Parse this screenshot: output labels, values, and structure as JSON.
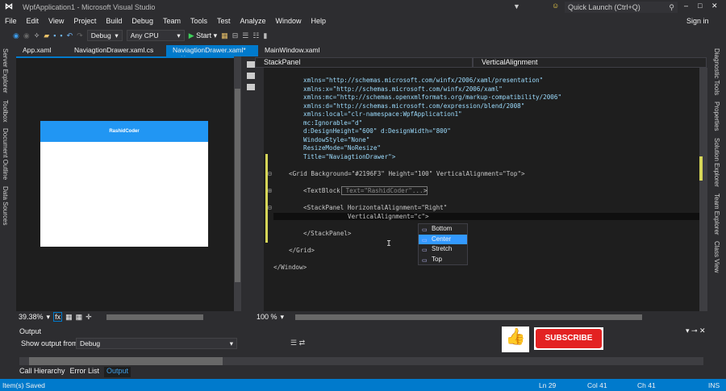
{
  "window": {
    "title": "WpfApplication1 - Microsoft Visual Studio",
    "quick_launch": "Quick Launch (Ctrl+Q)",
    "sign_in": "Sign in"
  },
  "menu": [
    "File",
    "Edit",
    "View",
    "Project",
    "Build",
    "Debug",
    "Team",
    "Tools",
    "Test",
    "Analyze",
    "Window",
    "Help"
  ],
  "toolbar": {
    "config": "Debug",
    "platform": "Any CPU",
    "start": "Start"
  },
  "left_strip": [
    "Server Explorer",
    "Toolbox",
    "Document Outline",
    "Data Sources"
  ],
  "right_strip": [
    "Diagnostic Tools",
    "Properties",
    "Solution Explorer",
    "Team Explorer",
    "Class View"
  ],
  "tabs": [
    {
      "label": "App.xaml"
    },
    {
      "label": "NaviagtionDrawer.xaml.cs"
    },
    {
      "label": "NaviagtionDrawer.xaml*"
    },
    {
      "label": "MainWindow.xaml"
    }
  ],
  "nav": {
    "left": "StackPanel",
    "right": "VerticalAlignment"
  },
  "designer": {
    "header_text": "RashidCoder",
    "header_color": "#2196F3",
    "zoom": "39.38%"
  },
  "code": {
    "lines": [
      "xmlns=\"http://schemas.microsoft.com/winfx/2006/xaml/presentation\"",
      "xmlns:x=\"http://schemas.microsoft.com/winfx/2006/xaml\"",
      "xmlns:mc=\"http://schemas.openxmlformats.org/markup-compatibility/2006\"",
      "xmlns:d=\"http://schemas.microsoft.com/expression/blend/2008\"",
      "xmlns:local=\"clr-namespace:WpfApplication1\"",
      "mc:Ignorable=\"d\"",
      "d:DesignHeight=\"600\" d:DesignWidth=\"800\"",
      "WindowStyle=\"None\"",
      "ResizeMode=\"NoResize\"",
      "Title=\"NaviagtionDrawer\">",
      "<Grid Background=\"#2196F3\" Height=\"100\" VerticalAlignment=\"Top\">",
      "<TextBlock",
      " Text=\"RashidCoder\"... ",
      ">",
      "<StackPanel HorizontalAlignment=\"Right\"",
      "VerticalAlignment=\"c\">",
      "</StackPanel>",
      "</Grid>",
      "</Window>"
    ],
    "zoom": "100 %"
  },
  "autocomplete": {
    "items": [
      "Bottom",
      "Center",
      "Stretch",
      "Top"
    ],
    "selected": "Center"
  },
  "output": {
    "title": "Output",
    "show_from_label": "Show output from:",
    "source": "Debug",
    "subscribe": "SUBSCRIBE"
  },
  "bottom_tabs": [
    "Call Hierarchy",
    "Error List",
    "Output"
  ],
  "status": {
    "message": "Item(s) Saved",
    "ln": "Ln 29",
    "col": "Col 41",
    "ch": "Ch 41",
    "mode": "INS"
  },
  "colors": {
    "accent": "#007acc",
    "chrome": "#2d2d30",
    "editor": "#1e1e1e"
  }
}
